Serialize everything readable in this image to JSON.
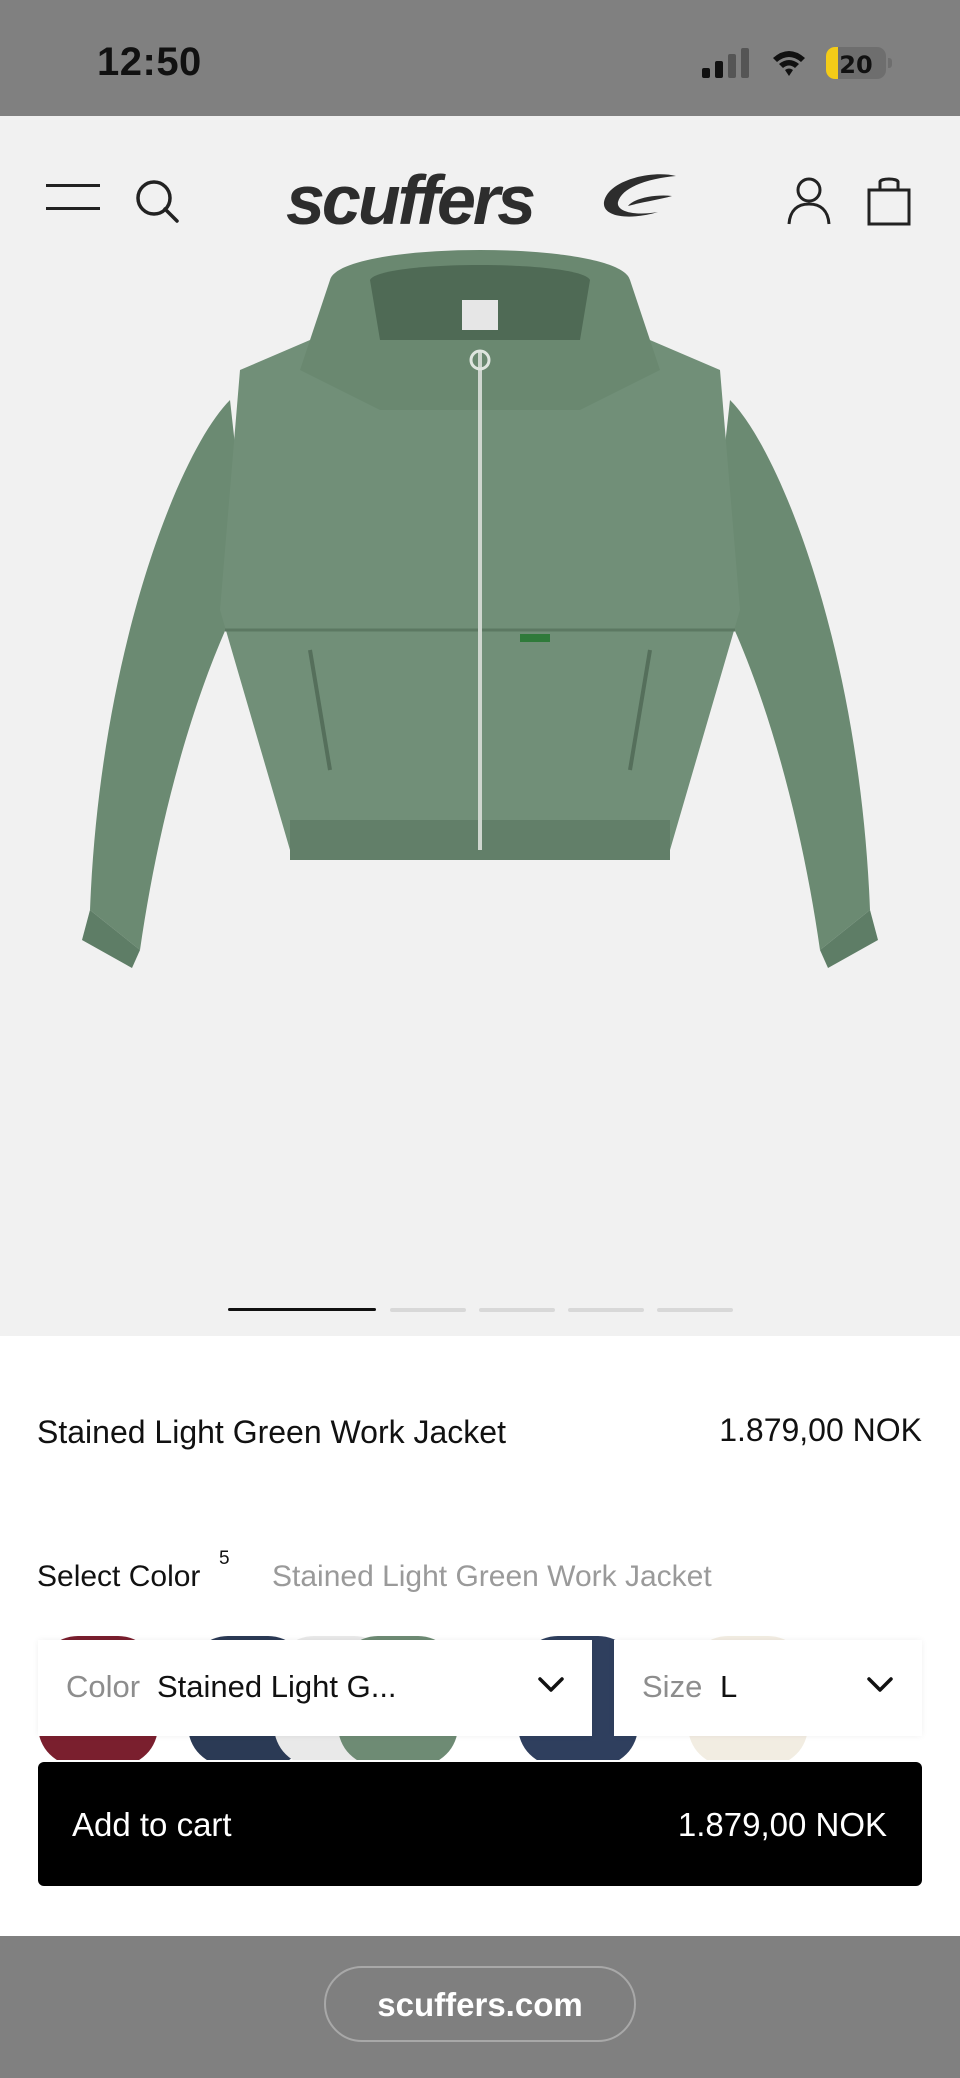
{
  "status_bar": {
    "time": "12:50",
    "battery_level": "20",
    "battery_fraction": 0.2,
    "signal_icon": "cellular-signal-icon",
    "wifi_icon": "wifi-icon"
  },
  "header": {
    "logo_text": "scuffers",
    "menu_icon": "hamburger-menu-icon",
    "search_icon": "search-icon",
    "account_icon": "user-account-icon",
    "cart_icon": "shopping-bag-icon"
  },
  "gallery": {
    "image_alt_icon": "green-hooded-work-jacket-image",
    "active_index": 0,
    "total_images": 5
  },
  "product": {
    "name": "Stained Light Green Work Jacket",
    "price": "1.879,00 NOK"
  },
  "color_selector": {
    "label": "Select Color",
    "count": "5",
    "selected_name": "Stained Light Green Work Jacket",
    "swatch_colors": [
      "#7a1f2e",
      "#2b3a55",
      "#e9e9e9",
      "#6e8b74",
      "#2f3f5e",
      "#f2ede2"
    ]
  },
  "dropdowns": {
    "color_label": "Color",
    "color_value": "Stained Light G...",
    "size_label": "Size",
    "size_value": "L"
  },
  "cta": {
    "label": "Add to cart",
    "price": "1.879,00 NOK"
  },
  "browser": {
    "url": "scuffers.com"
  },
  "colors": {
    "accent": "#000000",
    "product_green": "#6d8b74",
    "battery_yellow": "#f4cc18"
  }
}
